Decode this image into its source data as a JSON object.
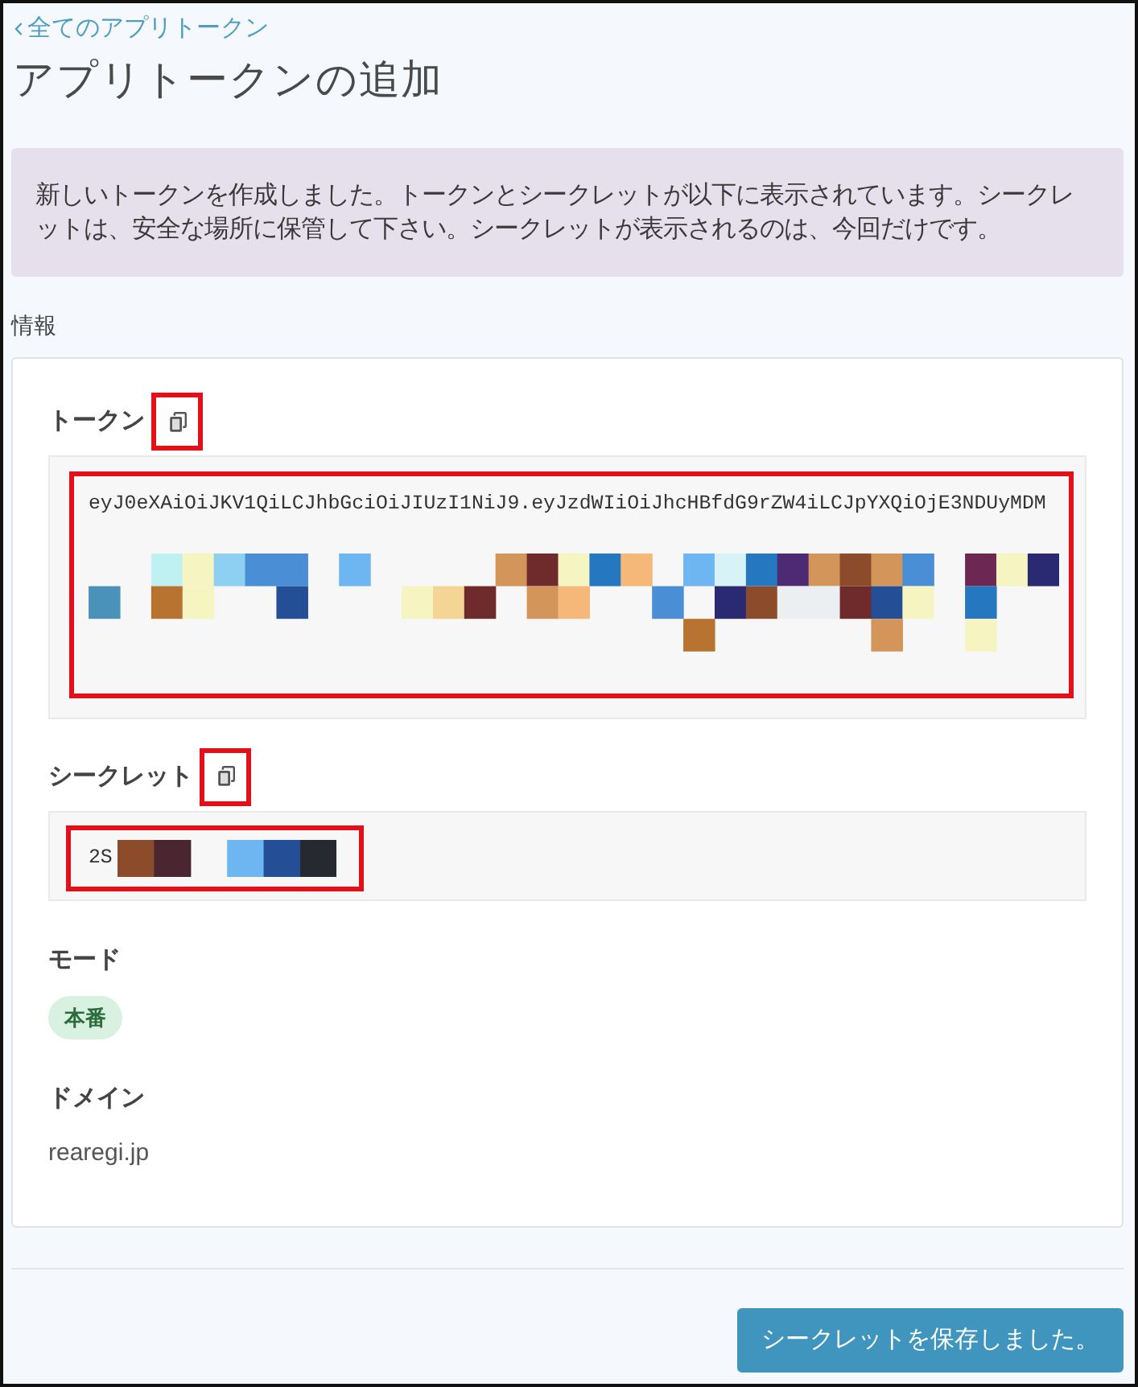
{
  "back_link": {
    "label": "全てのアプリトークン"
  },
  "title": "アプリトークンの追加",
  "notice": {
    "text": "新しいトークンを作成しました。トークンとシークレットが以下に表示されています。シークレットは、安全な場所に保管して下さい。シークレットが表示されるのは、今回だけです。"
  },
  "section_label": "情報",
  "fields": [
    {
      "kind": "secret",
      "label": "トークン",
      "copy_highlighted": true,
      "value": "eyJ0eXAiOiJKV1QiLCJhbGciOiJIUzI1NiJ9.eyJzdWIiOiJhcHBfdG9rZW4iLCJpYXQiOjE3NDUyMDM",
      "redacted": true,
      "highlighted": true
    },
    {
      "kind": "secret",
      "label": "シークレット",
      "copy_highlighted": true,
      "value": "2S",
      "redacted": true,
      "highlighted": true
    },
    {
      "kind": "badge",
      "label": "モード",
      "value": "本番"
    },
    {
      "kind": "text",
      "label": "ドメイン",
      "value": "rearegi.jp"
    }
  ],
  "save_button": {
    "label": "シークレットを保存しました。"
  }
}
